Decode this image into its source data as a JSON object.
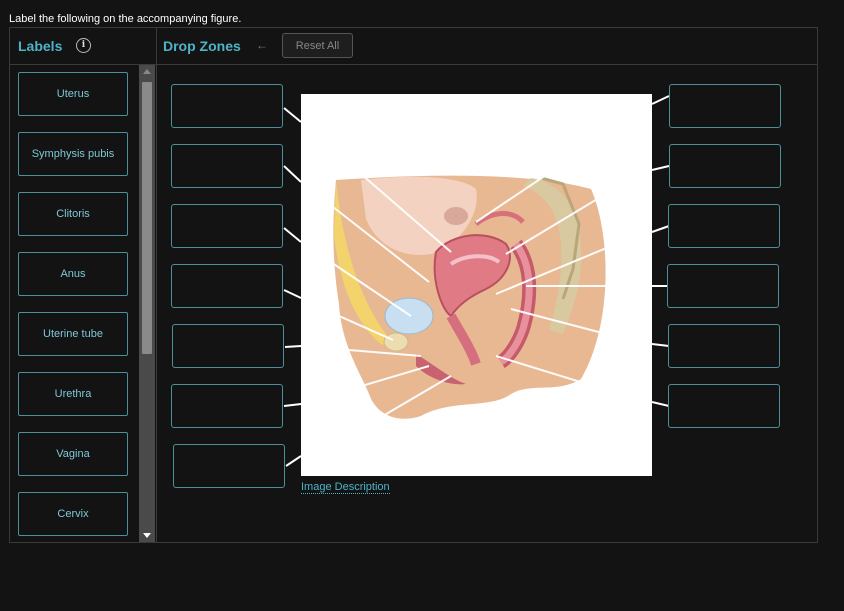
{
  "instruction": "Label the following on the accompanying figure.",
  "labels_panel": {
    "title": "Labels",
    "info_icon": "info-circle-icon",
    "items": [
      "Uterus",
      "Symphysis pubis",
      "Clitoris",
      "Anus",
      "Uterine tube",
      "Urethra",
      "Vagina",
      "Cervix"
    ]
  },
  "drop_panel": {
    "title": "Drop Zones",
    "undo_icon": "undo-arrow-icon",
    "reset_label": "Reset All"
  },
  "figure": {
    "description_link": "Image Description"
  },
  "colors": {
    "accent": "#4fb3c8",
    "card_border": "#4a8f9a",
    "background": "#131313"
  }
}
